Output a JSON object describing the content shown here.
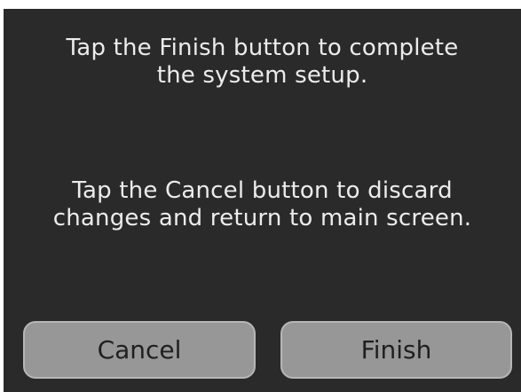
{
  "dialog": {
    "finish_message_line1": "Tap the Finish button to complete",
    "finish_message_line2": "the system setup.",
    "cancel_message_line1": "Tap the Cancel button to discard",
    "cancel_message_line2": "changes and return to main screen.",
    "cancel_label": "Cancel",
    "finish_label": "Finish"
  },
  "colors": {
    "background": "#2a2a2a",
    "text": "#ececec",
    "button": "#979797",
    "button_text": "#1f1f1f"
  }
}
